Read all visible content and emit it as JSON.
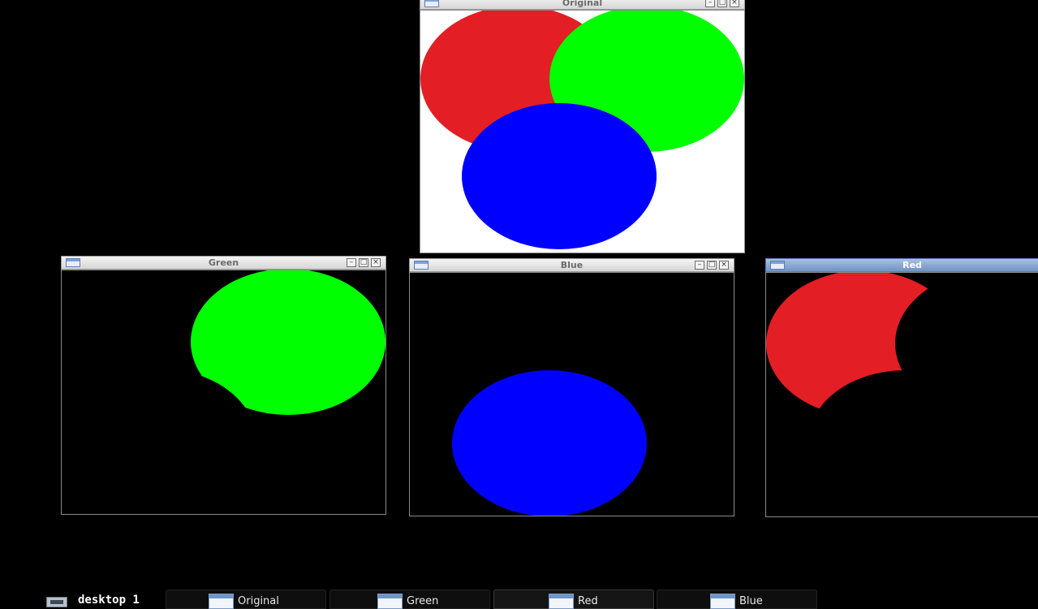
{
  "windows": {
    "original": {
      "title": "Original"
    },
    "green": {
      "title": "Green"
    },
    "blue": {
      "title": "Blue"
    },
    "red": {
      "title": "Red"
    }
  },
  "colors": {
    "red": "#e31e24",
    "green": "#00ff00",
    "blue": "#0000ff",
    "canvas_white": "#ffffff",
    "canvas_black": "#000000"
  },
  "taskbar": {
    "desktop_label": "desktop 1",
    "tasks": [
      {
        "label": "Original",
        "active": false
      },
      {
        "label": "Green",
        "active": false
      },
      {
        "label": "Red",
        "active": true
      },
      {
        "label": "Blue",
        "active": false
      }
    ]
  }
}
